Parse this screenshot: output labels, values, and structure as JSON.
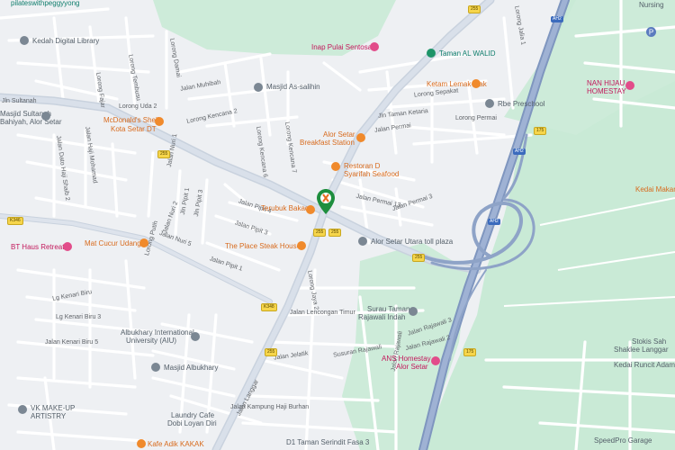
{
  "colors": {
    "land": "#eef0f3",
    "green": "#c9ead6",
    "road": "#ffffff",
    "major_road": "#d6dce6",
    "highway": "#8ea3c7",
    "orange_poi": "#d86b1e",
    "pink_poi": "#c2185b",
    "teal_poi": "#0f7d6c",
    "selected_pin": "#1e8e3e"
  },
  "streets": {
    "jalan_sultanah": "Jln Sultanah",
    "lorong_uda_2": "Lorong Uda 2",
    "lorong_kencana_2": "Lorong Kencana 2",
    "jalan_muhibah": "Jalan Muhibah",
    "lorong_fajar": "Lorong Fajar",
    "lorong_tembusu": "Lorong Tembusu",
    "lorong_damai": "Lorong Damai",
    "lorong_kencana_7": "Lorong Kencana 7",
    "lorong_kencana_6": "Lorong Kencana 6",
    "jalan_dato_haji_shaib_2": "Jalan Dato Haji Shaib 2",
    "jalan_haji_mohamad": "Jalan Haji Mohamad",
    "jalan_nuri_1": "Jalan Nuri 1",
    "jalan_nuri_2": "Jalan Nuri 2",
    "jalan_nuri_5": "Jalan Nuri 5",
    "jalan_pipit_1_top": "Jln Pipit 1",
    "jalan_pipit_3_top": "Jln Pipit 3",
    "jalan_pipit_4": "Jalan Pipit 4",
    "jalan_pipit_3": "Jalan Pipit 3",
    "jalan_pipit_1": "Jalan Pipit 1",
    "lorong_putih": "Lorong Putih",
    "lg_kenari_biru": "Lg Kenari Biru",
    "lg_kenari_biru_3": "Lg Kenari Biru 3",
    "jalan_kenari_biru_5": "Jalan Kenari Biru 5",
    "jalan_lencongan_timur": "Jalan Lencongan Timur",
    "lorong_jaya_2": "Lorong Jaya 2",
    "jalan_jelatik": "Jalan Jelatik",
    "jalan_langgar": "Jalan Langgar",
    "jalan_kampung_haji_burhan": "Jalan Kampung Haji Burhan",
    "susuran_rajawali": "Susuran Rajawali",
    "jalan_rajawali_3": "Jalan Rajawali 3",
    "jalan_rajawali_2": "Jalan Rajawali 2",
    "jalan_rajawali_1": "Jalan Rajawali",
    "jalan_permai": "Jalan Permai",
    "jalan_permai_13": "Jalan Permai 13",
    "jalan_permai_3": "Jalan Permai 3",
    "lorong_permai": "Lorong Permai",
    "lorong_sepakat": "Lorong Sepakat",
    "jln_taman_ketaria": "Jln Taman Ketaria",
    "lorong_jalia_1": "Lorong Jalia 1"
  },
  "pois": {
    "pilates": "pilateswithpeggyyong",
    "kedah_digital_library": "Kedah Digital Library",
    "masjid_as_salihin": "Masjid As-salihin",
    "inap_pulai": "Inap Pulai Sentosa",
    "taman_al_walid": "Taman AL WALID",
    "ketam_lemak": "Ketam Lemak Mak",
    "rbe_preschool": "Rbe Preschool",
    "mcdonalds_1": "McDonald's Shell",
    "mcdonalds_2": "Kota Setar DT",
    "alor_setar_breakfast_1": "Alor Setar",
    "alor_setar_breakfast_2": "Breakfast Station",
    "restoran_d_1": "Restoran D",
    "restoran_d_2": "Syarifah Seafood",
    "terubuk_bakar": "Terubuk Bakaq",
    "place_steak": "The Place Steak House",
    "alor_setar_toll": "Alor Setar Utara toll plaza",
    "mat_cucur": "Mat Cucur Udang",
    "bt_haus": "BT Haus Retreat",
    "masjid_sultanah_1": "Masjid Sultanah",
    "masjid_sultanah_2": "Bahiyah, Alor Setar",
    "albukhary_univ_1": "Albukhary International",
    "albukhary_univ_2": "University (AIU)",
    "masjid_albukhary": "Masjid Albukhary",
    "surau_1": "Surau Taman",
    "surau_2": "Rajawali Indah",
    "ans_homestay_1": "ANS Homestay",
    "ans_homestay_2": "Alor Setar",
    "nan_hijau_1": "NAN HIJAU",
    "nan_hijau_2": "HOMESTAY",
    "kedai_makan": "Kedai Makan",
    "stokis_1": "Stokis Sah",
    "stokis_2": "Shaklee Langgar",
    "kedai_runcit": "Kedai Runcit Adam",
    "speedpro": "SpeedPro Garage",
    "vk_makeup_1": "VK MAKE-UP",
    "vk_makeup_2": "ARTISTRY",
    "laundry_1": "Laundry Cafe",
    "laundry_2": "Dobi Loyan Diri",
    "kafe_adik": "Kafe Adik KAKAK",
    "taman_serindit": "D1 Taman Serindit Fasa 3",
    "nursing": "Nursing"
  },
  "road_shields": {
    "r255_top": "255",
    "r255_mid": "255",
    "r255_a": "255",
    "r255_b": "255",
    "k346": "K346",
    "k348": "K348",
    "r255_low": "255",
    "r255_toll": "255",
    "r255_east": "255",
    "r175_1": "175",
    "r175_2": "175",
    "ah2_top": "AH2",
    "ah2_mid": "AH2",
    "ah2_low": "AH2",
    "r1_label": "Jalan Sultan",
    "r1_label2": "Jalan Sultan",
    "r1_lbl_a": "Jalan Sultan"
  },
  "icons": {
    "selected_pin": "restaurant-pin-selected",
    "parking": "parking-icon",
    "mosque": "mosque-icon",
    "restaurant": "restaurant-icon",
    "hotel": "hotel-icon",
    "school": "school-icon",
    "park": "park-icon",
    "toll": "toll-icon"
  },
  "parking_label": "P"
}
